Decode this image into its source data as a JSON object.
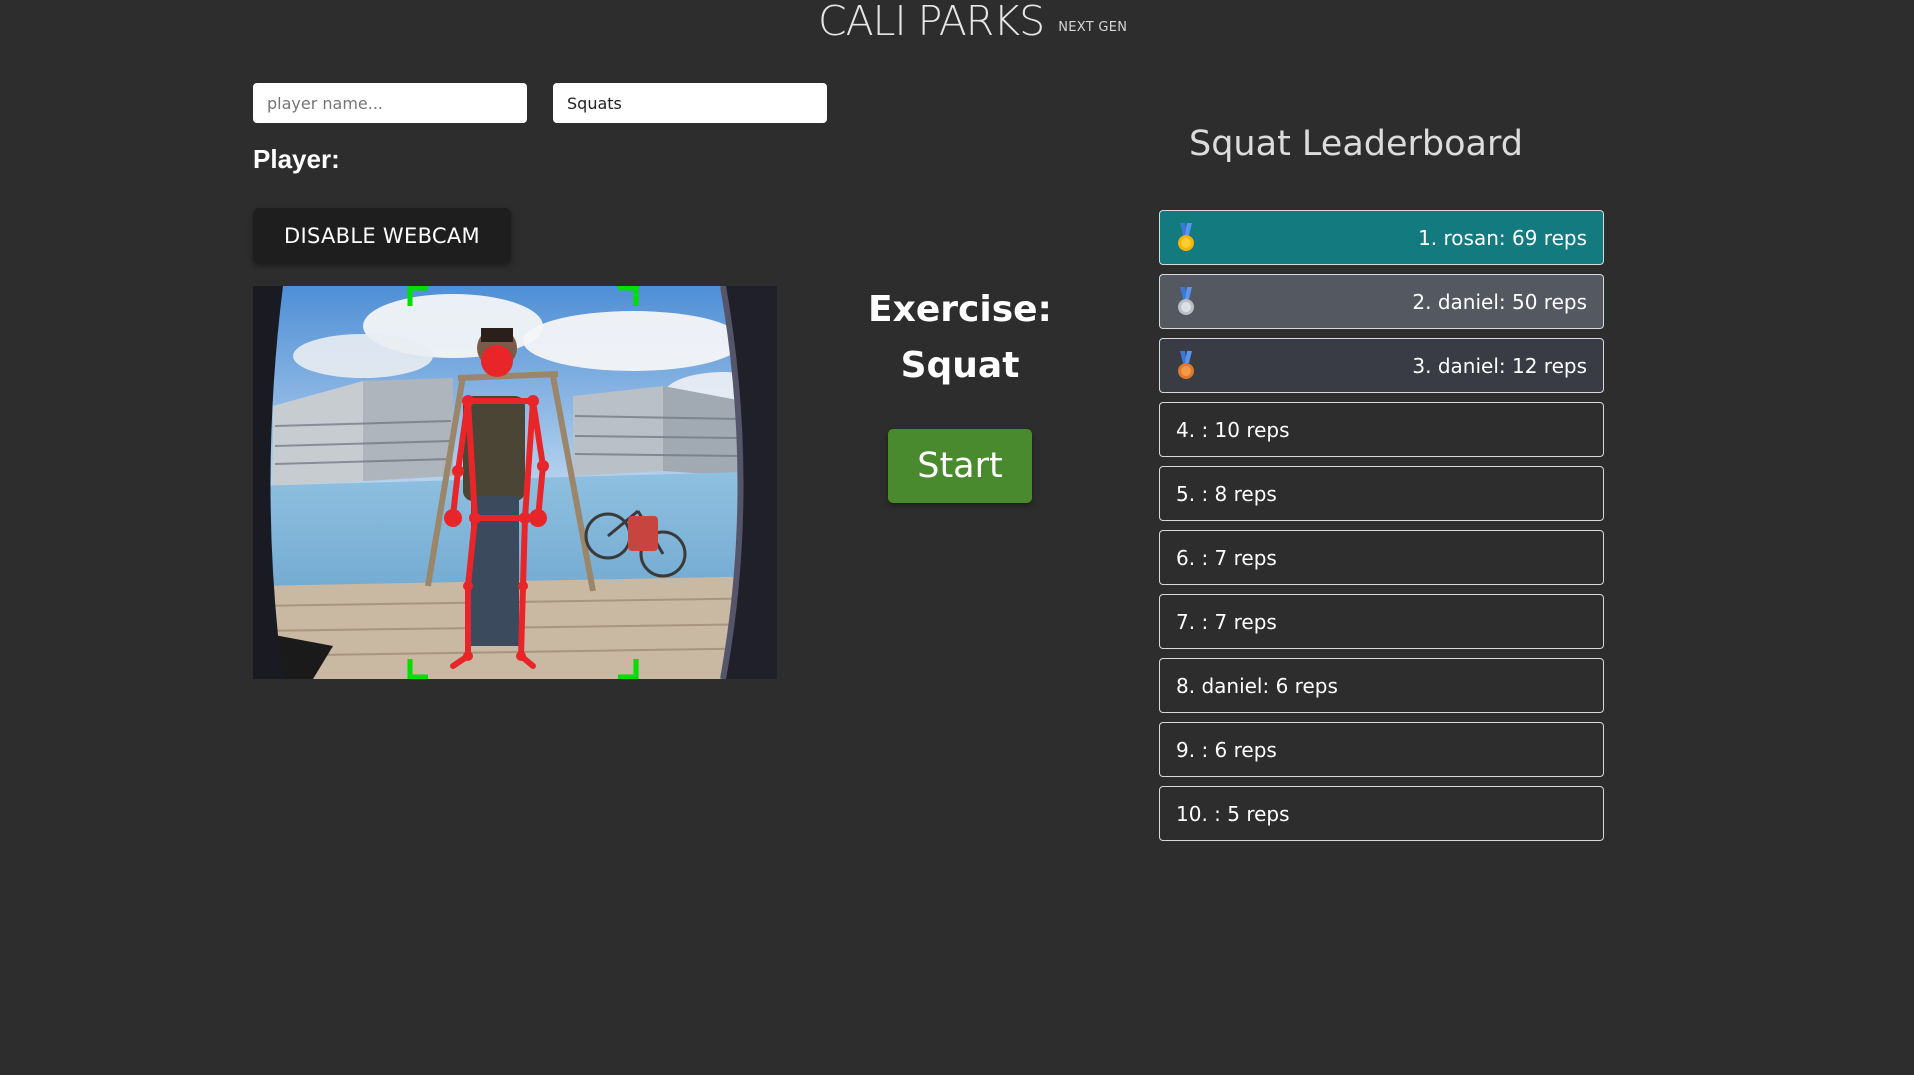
{
  "header": {
    "title": "CALI PARKS",
    "subtitle": "NEXT GEN"
  },
  "form": {
    "player_name_placeholder": "player name...",
    "exercise_value": "Squats"
  },
  "player": {
    "label": "Player:"
  },
  "webcam": {
    "toggle_label": "DISABLE WEBCAM"
  },
  "exercise": {
    "heading": "Exercise:",
    "name": "Squat",
    "start_label": "Start"
  },
  "leaderboard": {
    "title": "Squat Leaderboard",
    "entries": [
      {
        "text": "1. rosan: 69 reps",
        "medal": "gold-medal-icon"
      },
      {
        "text": "2. daniel: 50 reps",
        "medal": "silver-medal-icon"
      },
      {
        "text": "3. daniel: 12 reps",
        "medal": "bronze-medal-icon"
      },
      {
        "text": "4. : 10 reps"
      },
      {
        "text": "5. : 8 reps"
      },
      {
        "text": "6. : 7 reps"
      },
      {
        "text": "7. : 7 reps"
      },
      {
        "text": "8. daniel: 6 reps"
      },
      {
        "text": "9. : 6 reps"
      },
      {
        "text": "10. : 5 reps"
      }
    ]
  },
  "colors": {
    "background": "#2d2d2d",
    "gold_row": "#137a7f",
    "silver_row": "#545861",
    "bronze_row": "#393c45",
    "start_button": "#4a8a2e",
    "pose_skeleton": "#e8262a",
    "frame_corners": "#00e000"
  }
}
